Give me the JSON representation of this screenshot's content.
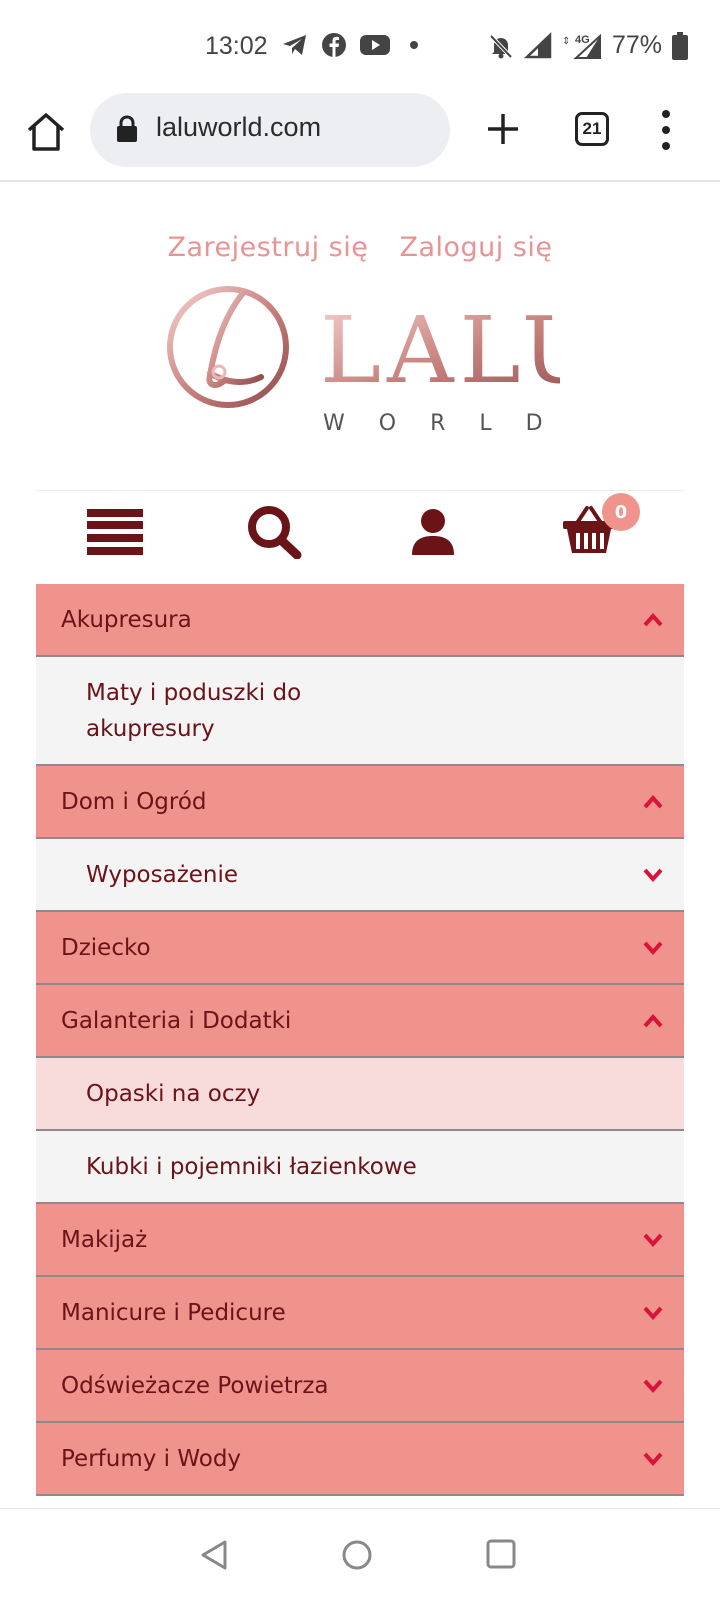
{
  "status_bar": {
    "time": "13:02",
    "battery": "77%",
    "icons": [
      "telegram-icon",
      "facebook-icon",
      "youtube-icon",
      "dot-icon",
      "muted-bell-icon",
      "signal-icon",
      "4g-signal-icon",
      "battery-icon"
    ]
  },
  "browser": {
    "url": "laluworld.com",
    "tab_count": "21"
  },
  "header": {
    "register_label": "Zarejestruj się",
    "login_label": "Zaloguj się",
    "logo_main": "LALU",
    "logo_sub": "WORLD"
  },
  "icon_bar": {
    "cart_count": "0"
  },
  "menu": {
    "items": [
      {
        "label": "Akupresura",
        "type": "category",
        "chevron": "up"
      },
      {
        "label": "Maty i poduszki do",
        "label2": "akupresury",
        "type": "subcategory"
      },
      {
        "label": "Dom i Ogród",
        "type": "category",
        "chevron": "up"
      },
      {
        "label": "Wyposażenie",
        "type": "subcategory",
        "chevron": "down"
      },
      {
        "label": "Dziecko",
        "type": "category",
        "chevron": "down"
      },
      {
        "label": "Galanteria i Dodatki",
        "type": "category",
        "chevron": "up"
      },
      {
        "label": "Opaski na oczy",
        "type": "subcategory",
        "active": true
      },
      {
        "label": "Kubki i pojemniki łazienkowe",
        "type": "subcategory"
      },
      {
        "label": "Makijaż",
        "type": "category",
        "chevron": "down"
      },
      {
        "label": "Manicure i Pedicure",
        "type": "category",
        "chevron": "down"
      },
      {
        "label": "Odświeżacze Powietrza",
        "type": "category",
        "chevron": "down"
      },
      {
        "label": "Perfumy i Wody",
        "type": "category",
        "chevron": "down"
      }
    ]
  },
  "colors": {
    "category_bg": "#f0938d",
    "subcategory_bg": "#f4f4f4",
    "active_bg": "#f8dcdc",
    "text_dark_red": "#6c1218",
    "chevron_red": "#d8143c",
    "link_pink": "#e89394",
    "icon_maroon": "#6b1418"
  }
}
